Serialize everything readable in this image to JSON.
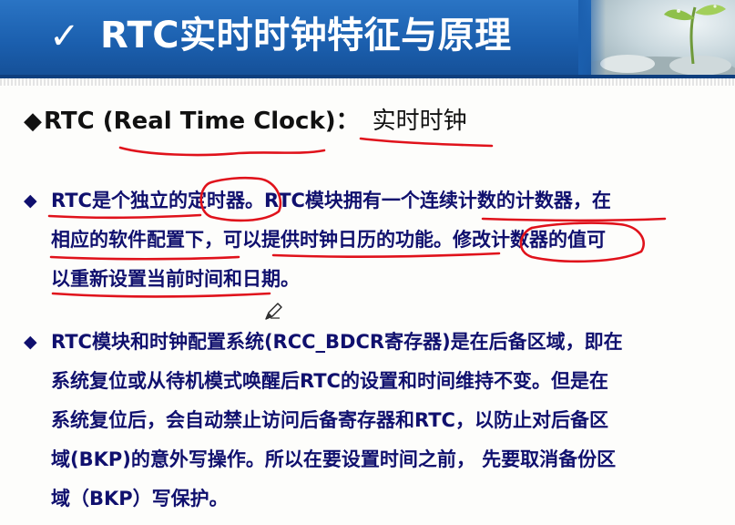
{
  "title": {
    "check": "✓",
    "text": "RTC实时时钟特征与原理"
  },
  "heading": {
    "bullet": "◆",
    "label": "RTC (Real Time Clock)：",
    "term": "实时时钟"
  },
  "paragraphs": [
    {
      "bullet": "◆",
      "lines": [
        "RTC是个独立的定时器。RTC模块拥有一个连续计数的计数器，在",
        "相应的软件配置下，可以提供时钟日历的功能。修改计数器的值可",
        "以重新设置当前时间和日期。"
      ]
    },
    {
      "bullet": "◆",
      "lines": [
        "RTC模块和时钟配置系统(RCC_BDCR寄存器)是在后备区域，即在",
        "系统复位或从待机模式唤醒后RTC的设置和时间维持不变。但是在",
        "系统复位后，会自动禁止访问后备寄存器和RTC，以防止对后备区",
        "域(BKP)的意外写操作。所以在要设置时间之前， 先要取消备份区",
        "域（BKP）写保护。"
      ]
    }
  ],
  "colors": {
    "title_bar": "#1b5fae",
    "body_text": "#10106e",
    "annotation_ink": "#e0121b"
  },
  "icons": {
    "cursor": "pen-cursor-icon",
    "photo": "sprout-photo"
  }
}
